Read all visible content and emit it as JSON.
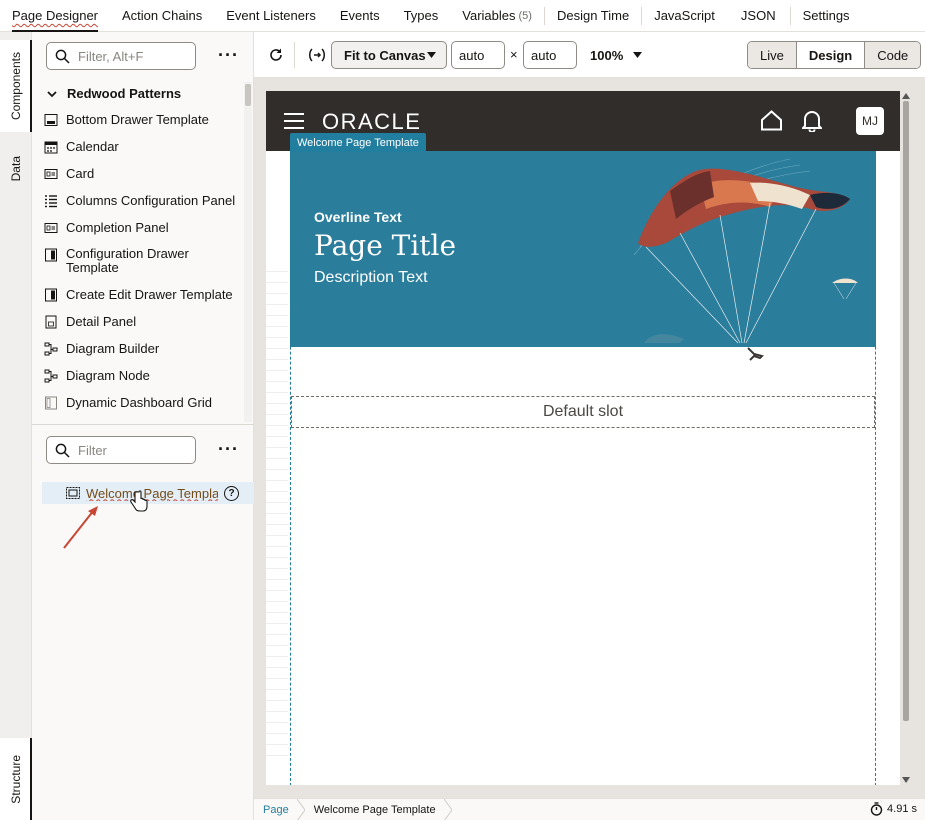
{
  "top_tabs": [
    {
      "label": "Page Designer"
    },
    {
      "label": "Action Chains"
    },
    {
      "label": "Event Listeners"
    },
    {
      "label": "Events"
    },
    {
      "label": "Types"
    },
    {
      "label": "Variables",
      "badge": "(5)"
    },
    {
      "label": "Design Time"
    },
    {
      "label": "JavaScript"
    },
    {
      "label": "JSON"
    },
    {
      "label": "Settings"
    }
  ],
  "rail": {
    "components": "Components",
    "data": "Data",
    "structure": "Structure"
  },
  "components_panel": {
    "search_placeholder": "Filter, Alt+F",
    "group": "Redwood Patterns",
    "items": [
      {
        "label": "Bottom Drawer Template",
        "icon": "bottom-drawer-icon"
      },
      {
        "label": "Calendar",
        "icon": "calendar-icon"
      },
      {
        "label": "Card",
        "icon": "card-icon"
      },
      {
        "label": "Columns Configuration Panel",
        "icon": "list-icon"
      },
      {
        "label": "Completion Panel",
        "icon": "card-icon"
      },
      {
        "label": "Configuration Drawer Template",
        "icon": "side-drawer-icon"
      },
      {
        "label": "Create Edit Drawer Template",
        "icon": "side-drawer-icon"
      },
      {
        "label": "Detail Panel",
        "icon": "document-icon"
      },
      {
        "label": "Diagram Builder",
        "icon": "diagram-icon"
      },
      {
        "label": "Diagram Node",
        "icon": "diagram-icon"
      },
      {
        "label": "Dynamic Dashboard Grid",
        "icon": "grid-icon"
      }
    ]
  },
  "structure_panel": {
    "search_placeholder": "Filter",
    "selected_item": "Welcome Page Template"
  },
  "toolbar": {
    "fit": "Fit to Canvas",
    "width": "auto",
    "times": "×",
    "height": "auto",
    "zoom": "100%",
    "modes": [
      "Live",
      "Design",
      "Code"
    ],
    "active_mode": "Design"
  },
  "preview": {
    "brand": "ORACLE",
    "avatar": "MJ",
    "template_tag": "Welcome Page Template",
    "overline": "Overline Text",
    "title": "Page Title",
    "description": "Description Text",
    "slot": "Default slot"
  },
  "statusbar": {
    "crumbs": [
      "Page",
      "Welcome Page Template"
    ],
    "time": "4.91 s"
  },
  "colors": {
    "accent": "#227e9e",
    "header": "#312d2a",
    "hero": "#2a7d9b",
    "arrow": "#c74634"
  }
}
